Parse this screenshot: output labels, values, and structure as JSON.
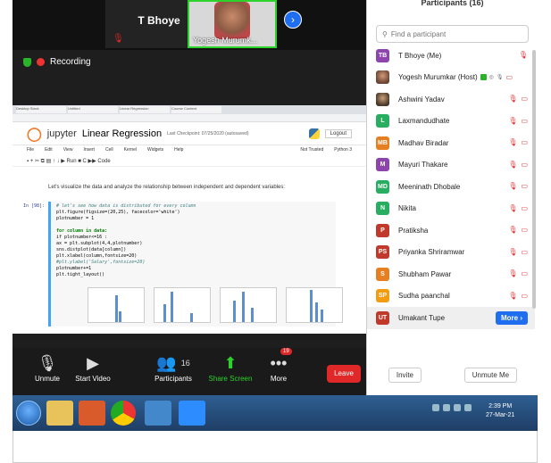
{
  "video": {
    "tile1_name": "T Bhoye",
    "tile2_name": "Yogesh Murumk...",
    "recording_label": "Recording"
  },
  "shared_screen": {
    "browser_tabs": [
      "Desktop Slack",
      "Untitled",
      "Linear Regression",
      "Course Content"
    ],
    "notebook_title": "Linear Regression",
    "checkpoint": "Last Checkpoint: 07/25/2020 (autosaved)",
    "logout": "Logout",
    "jupyter_word": "jupyter",
    "menu": [
      "File",
      "Edit",
      "View",
      "Insert",
      "Cell",
      "Kernel",
      "Widgets",
      "Help"
    ],
    "trusted": "Not Trusted",
    "kernel": "Python 3",
    "markdown_text": "Let's visualize the data and analyze the relationship between independent and dependent variables:",
    "prompt": "In [98]:",
    "code_lines": [
      "# let's see how data is distributed for every column",
      "plt.figure(figsize=(20,25), facecolor='white')",
      "plotnumber = 1",
      "",
      "for column in data:",
      "    if plotnumber<=16 :",
      "        ax = plt.subplot(4,4,plotnumber)",
      "        sns.distplot(data[column])",
      "        plt.xlabel(column,fontsize=20)",
      "        #plt.ylabel('Salary',fontsize=20)",
      "    plotnumber+=1",
      "plt.tight_layout()"
    ]
  },
  "toolbar": {
    "mute": "Unmute",
    "video": "Start Video",
    "participants": "Participants",
    "participants_count": "16",
    "share": "Share Screen",
    "more": "More",
    "more_badge": "19",
    "leave": "Leave"
  },
  "panel": {
    "title": "Participants (16)",
    "search_placeholder": "Find a participant",
    "participants": [
      {
        "initials": "TB",
        "name": "T Bhoye (Me)",
        "color": "#8e44ad"
      },
      {
        "initials": "",
        "name": "Yogesh Murumkar (Host)",
        "color": "#6b4433"
      },
      {
        "initials": "",
        "name": "Ashwini Yadav",
        "color": "#5a4a3a"
      },
      {
        "initials": "L",
        "name": "Laxmandudhate",
        "color": "#27ae60"
      },
      {
        "initials": "MB",
        "name": "Madhav Biradar",
        "color": "#e67e22"
      },
      {
        "initials": "M",
        "name": "Mayuri Thakare",
        "color": "#8e44ad"
      },
      {
        "initials": "MD",
        "name": "Meeninath Dhobale",
        "color": "#27ae60"
      },
      {
        "initials": "N",
        "name": "Nikita",
        "color": "#27ae60"
      },
      {
        "initials": "P",
        "name": "Pratiksha",
        "color": "#c0392b"
      },
      {
        "initials": "PS",
        "name": "Priyanka Shriramwar",
        "color": "#c0392b"
      },
      {
        "initials": "S",
        "name": "Shubham Pawar",
        "color": "#e67e22"
      },
      {
        "initials": "SP",
        "name": "Sudha paanchal",
        "color": "#f39c12"
      },
      {
        "initials": "UT",
        "name": "Umakant Tupe",
        "color": "#c0392b"
      }
    ],
    "more_button": "More",
    "invite": "Invite",
    "unmute_me": "Unmute Me"
  },
  "taskbar": {
    "time": "2:39 PM",
    "date": "27-Mar-21"
  }
}
